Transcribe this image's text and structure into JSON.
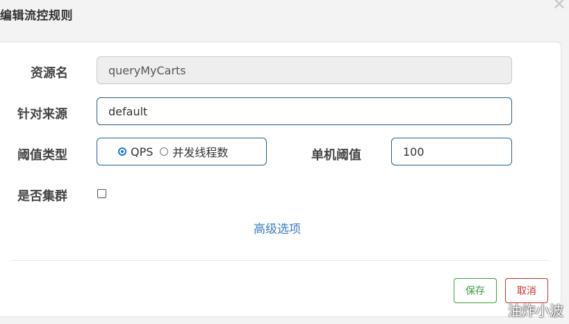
{
  "dialog": {
    "title": "编辑流控规则",
    "close_glyph": "✕"
  },
  "form": {
    "resource": {
      "label": "资源名",
      "value": "queryMyCarts"
    },
    "origin": {
      "label": "针对来源",
      "value": "default"
    },
    "threshold_type": {
      "label": "阈值类型",
      "options": [
        "QPS",
        "并发线程数"
      ],
      "selected": "QPS"
    },
    "single_threshold": {
      "label": "单机阈值",
      "value": "100"
    },
    "cluster": {
      "label": "是否集群",
      "checked": false
    },
    "advanced_link": "高级选项"
  },
  "footer": {
    "save_label": "保存",
    "cancel_label": "取消"
  },
  "watermark": "油炸小波",
  "colors": {
    "input_border": "#1f5f8b",
    "link": "#3a7ebf",
    "save": "#3c9a3c",
    "cancel": "#c9302c"
  }
}
